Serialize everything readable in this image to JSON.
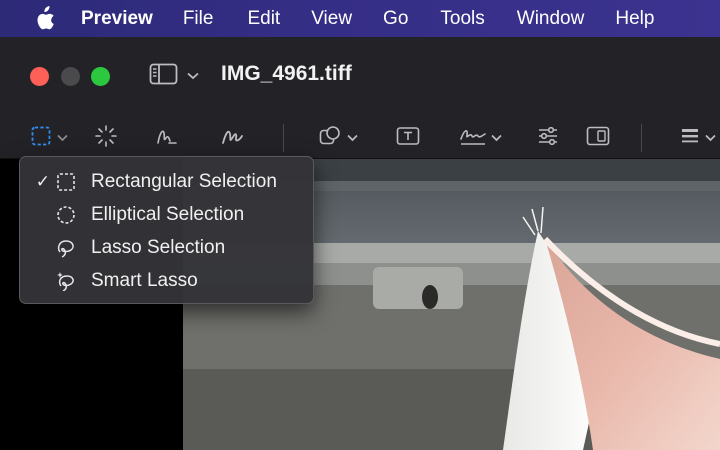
{
  "menubar": {
    "items": [
      "Preview",
      "File",
      "Edit",
      "View",
      "Go",
      "Tools",
      "Window",
      "Help"
    ]
  },
  "window": {
    "title": "IMG_4961.tiff"
  },
  "selection_menu": {
    "items": [
      {
        "label": "Rectangular Selection",
        "checked": true,
        "icon": "rectangular-selection-icon"
      },
      {
        "label": "Elliptical Selection",
        "checked": false,
        "icon": "elliptical-selection-icon"
      },
      {
        "label": "Lasso Selection",
        "checked": false,
        "icon": "lasso-selection-icon"
      },
      {
        "label": "Smart Lasso",
        "checked": false,
        "icon": "smart-lasso-icon"
      }
    ],
    "check_glyph": "✓"
  },
  "colors": {
    "accent": "#2f8ff0",
    "menubar": "#352e86",
    "titlebar": "#232327",
    "close": "#fe5f57",
    "zoom": "#2bc840"
  }
}
